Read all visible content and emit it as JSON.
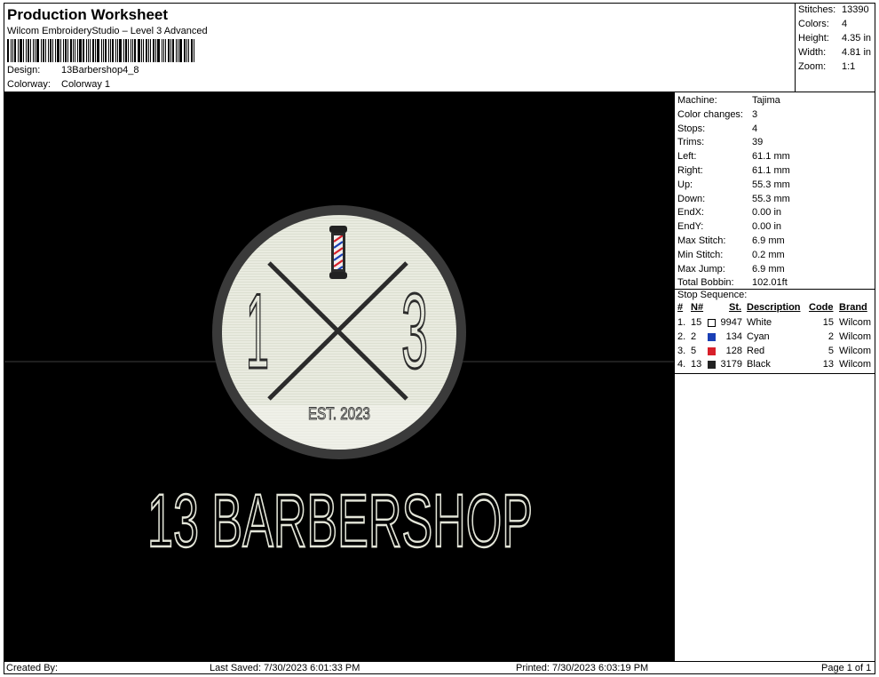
{
  "header": {
    "title": "Production Worksheet",
    "subtitle": "Wilcom EmbroideryStudio – Level 3 Advanced",
    "design_label": "Design:",
    "design_value": "13Barbershop4_8",
    "colorway_label": "Colorway:",
    "colorway_value": "Colorway 1"
  },
  "stats": {
    "stitches_label": "Stitches:",
    "stitches_value": "13390",
    "colors_label": "Colors:",
    "colors_value": "4",
    "height_label": "Height:",
    "height_value": "4.35 in",
    "width_label": "Width:",
    "width_value": "4.81 in",
    "zoom_label": "Zoom:",
    "zoom_value": "1:1"
  },
  "machine": {
    "rows": [
      {
        "label": "Machine:",
        "value": "Tajima"
      },
      {
        "label": "Color changes:",
        "value": "3"
      },
      {
        "label": "Stops:",
        "value": "4"
      },
      {
        "label": "Trims:",
        "value": "39"
      },
      {
        "label": "Left:",
        "value": "61.1 mm"
      },
      {
        "label": "Right:",
        "value": "61.1 mm"
      },
      {
        "label": "Up:",
        "value": "55.3 mm"
      },
      {
        "label": "Down:",
        "value": "55.3 mm"
      },
      {
        "label": "EndX:",
        "value": "0.00 in"
      },
      {
        "label": "EndY:",
        "value": "0.00 in"
      },
      {
        "label": "Max Stitch:",
        "value": "6.9 mm"
      },
      {
        "label": "Min Stitch:",
        "value": "0.2 mm"
      },
      {
        "label": "Max Jump:",
        "value": "6.9 mm"
      },
      {
        "label": "Total Bobbin:",
        "value": "102.01ft"
      }
    ]
  },
  "stop_sequence": {
    "title": "Stop Sequence:",
    "headers": {
      "num": "#",
      "n": "N#",
      "st": "St.",
      "description": "Description",
      "code": "Code",
      "brand": "Brand"
    },
    "rows": [
      {
        "num": "1.",
        "n": "15",
        "color": "#ffffff",
        "st": "9947",
        "description": "White",
        "code": "15",
        "brand": "Wilcom"
      },
      {
        "num": "2.",
        "n": "2",
        "color": "#1a3fb5",
        "st": "134",
        "description": "Cyan",
        "code": "2",
        "brand": "Wilcom"
      },
      {
        "num": "3.",
        "n": "5",
        "color": "#d8202a",
        "st": "128",
        "description": "Red",
        "code": "5",
        "brand": "Wilcom"
      },
      {
        "num": "4.",
        "n": "13",
        "color": "#222222",
        "st": "3179",
        "description": "Black",
        "code": "13",
        "brand": "Wilcom"
      }
    ]
  },
  "design": {
    "digit_left": "1",
    "digit_right": "3",
    "est": "EST. 2023",
    "wordmark": "13 BARBERSHOP",
    "colors": {
      "background": "#000000",
      "patch": "#e9ebe0",
      "ring": "#3a3a3a",
      "ink": "#2b2b2b",
      "text": "#e4e6d9"
    }
  },
  "footer": {
    "created_by": "Created By:",
    "last_saved": "Last Saved: 7/30/2023 6:01:33 PM",
    "printed": "Printed: 7/30/2023 6:03:19 PM",
    "page": "Page 1 of 1"
  }
}
